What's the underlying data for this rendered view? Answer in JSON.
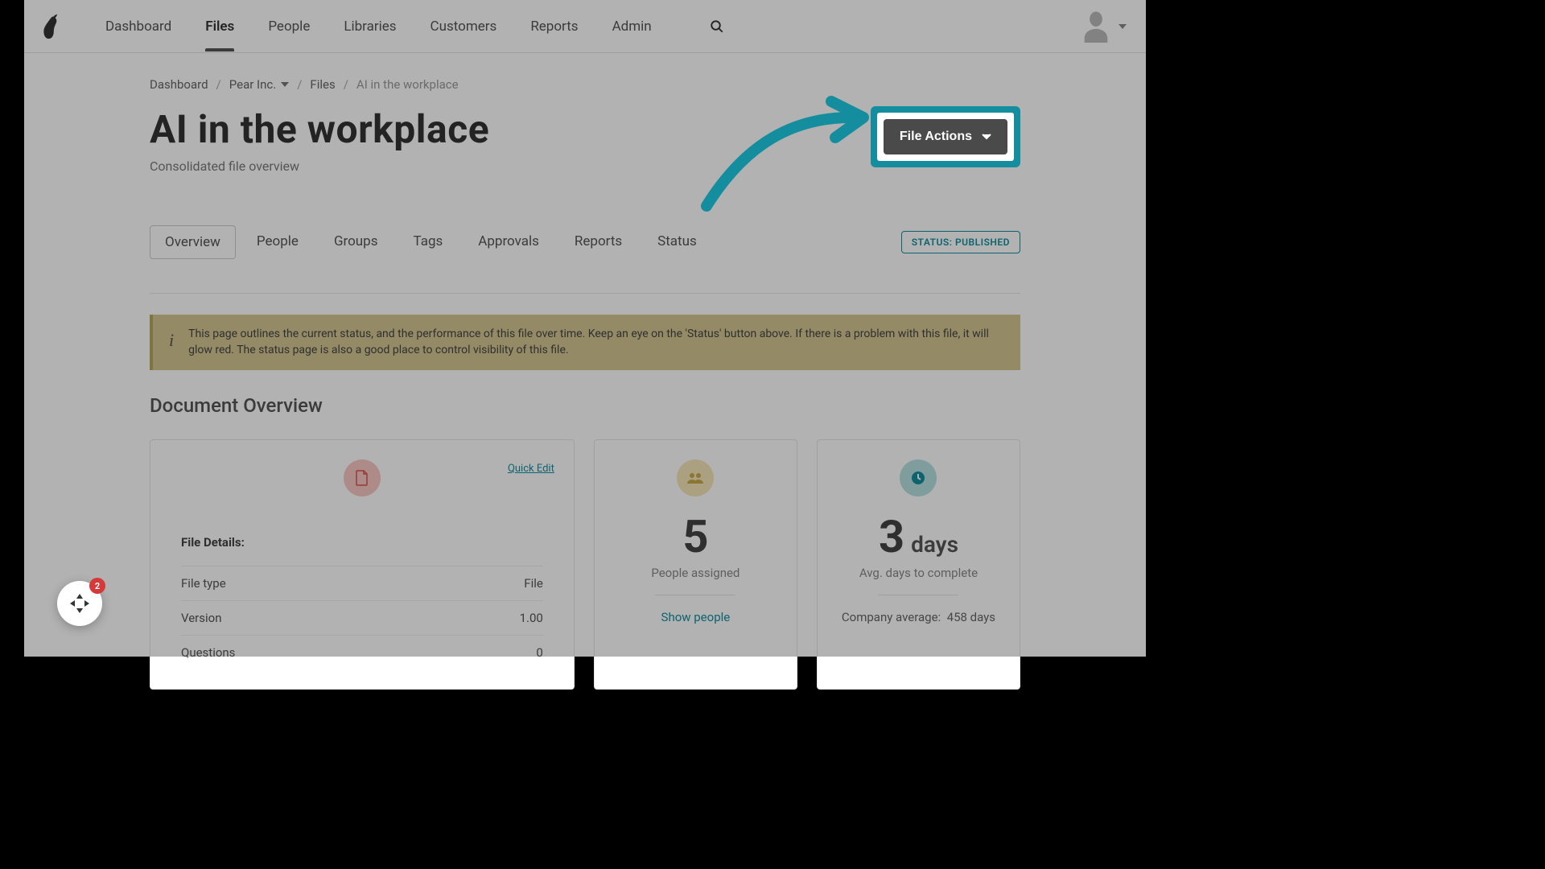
{
  "nav": {
    "items": [
      {
        "label": "Dashboard"
      },
      {
        "label": "Files"
      },
      {
        "label": "People"
      },
      {
        "label": "Libraries"
      },
      {
        "label": "Customers"
      },
      {
        "label": "Reports"
      },
      {
        "label": "Admin"
      }
    ],
    "active_index": 1
  },
  "breadcrumb": {
    "items": [
      {
        "label": "Dashboard"
      },
      {
        "label": "Pear Inc."
      },
      {
        "label": "Files"
      }
    ],
    "current": "AI in the workplace"
  },
  "page": {
    "title": "AI in the workplace",
    "subtitle": "Consolidated file overview"
  },
  "file_actions": {
    "label": "File Actions"
  },
  "subtabs": {
    "items": [
      {
        "label": "Overview"
      },
      {
        "label": "People"
      },
      {
        "label": "Groups"
      },
      {
        "label": "Tags"
      },
      {
        "label": "Approvals"
      },
      {
        "label": "Reports"
      },
      {
        "label": "Status"
      }
    ],
    "active_index": 0
  },
  "status_chip": {
    "prefix": "STATUS: ",
    "value": "PUBLISHED"
  },
  "info_banner": "This page outlines the current status, and the performance of this file over time. Keep an eye on the 'Status' button above. If there is a problem with this file, it will glow red. The status page is also a good place to control visibility of this file.",
  "section_heading": "Document Overview",
  "file_card": {
    "quick_edit": "Quick Edit",
    "details_head": "File Details:",
    "rows": [
      {
        "label": "File type",
        "value": "File"
      },
      {
        "label": "Version",
        "value": "1.00"
      },
      {
        "label": "Questions",
        "value": "0"
      }
    ]
  },
  "people_card": {
    "number": "5",
    "subtitle": "People assigned",
    "link": "Show people"
  },
  "days_card": {
    "number": "3",
    "unit": "days",
    "subtitle": "Avg. days to complete",
    "note_label": "Company average:",
    "note_value": "458 days"
  },
  "widget": {
    "badge": "2"
  }
}
